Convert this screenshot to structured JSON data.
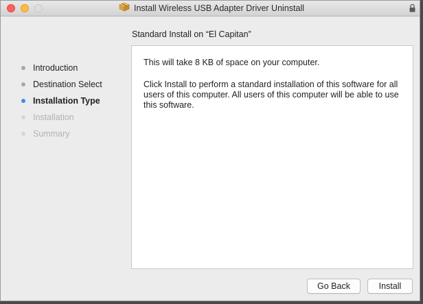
{
  "window": {
    "title": "Install Wireless USB Adapter Driver Uninstall",
    "icons": {
      "title_icon": "package-icon",
      "lock": "lock-icon"
    }
  },
  "sidebar": {
    "items": [
      {
        "label": "Introduction",
        "state": "completed"
      },
      {
        "label": "Destination Select",
        "state": "completed"
      },
      {
        "label": "Installation Type",
        "state": "current"
      },
      {
        "label": "Installation",
        "state": "upcoming"
      },
      {
        "label": "Summary",
        "state": "upcoming"
      }
    ]
  },
  "main": {
    "heading": "Standard Install on “El Capitan”",
    "space_text": "This will take 8 KB of space on your computer.",
    "description": "Click Install to perform a standard installation of this software for all users of this computer. All users of this computer will be able to use this software."
  },
  "buttons": {
    "go_back": "Go Back",
    "install": "Install"
  },
  "colors": {
    "active_dot": "#3a8ee6",
    "close": "#fc605c",
    "minimize": "#fdbc40",
    "zoom": "#dedede"
  }
}
